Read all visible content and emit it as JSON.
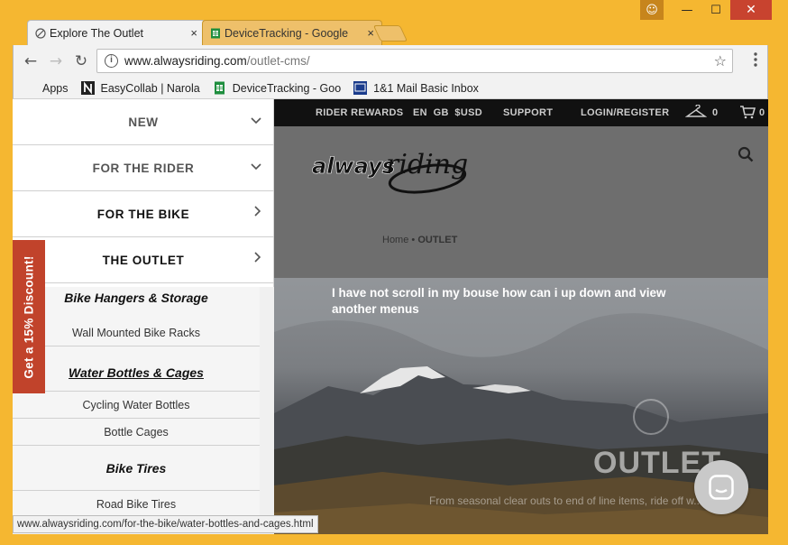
{
  "window": {
    "controls": {
      "user": "☺",
      "minimize": "—",
      "maximize": "☐",
      "close": "✕"
    }
  },
  "tabs": [
    {
      "label": "Explore The Outlet",
      "icon": "site-favicon",
      "close": "×"
    },
    {
      "label": "DeviceTracking - Google",
      "icon": "sheets-icon",
      "close": "×"
    }
  ],
  "toolbar": {
    "back": "←",
    "forward": "→",
    "reload": "↻",
    "url_host": "www.alwaysriding.com",
    "url_path": "/outlet-cms/",
    "star": "☆",
    "menu": "⋮"
  },
  "bookmarks": [
    {
      "label": "Apps",
      "icon": "apps-grid-icon"
    },
    {
      "label": "EasyCollab | Narola",
      "icon": "n-logo-icon"
    },
    {
      "label": "DeviceTracking - Goo",
      "icon": "sheets-icon"
    },
    {
      "label": "1&1 Mail Basic Inbox",
      "icon": "mail-icon"
    }
  ],
  "site": {
    "topbar": {
      "rewards": "RIDER REWARDS",
      "locale": "EN  GB  $USD",
      "support": "SUPPORT",
      "login": "LOGIN/REGISTER",
      "wishlist_count": "0",
      "cart_count": "0"
    },
    "breadcrumb": {
      "home": "Home",
      "sep": "•",
      "current": "OUTLET"
    },
    "hero": {
      "note": "I have not scroll in my bouse how can i up down and view another menus",
      "title": "OUTLET",
      "subtitle": "From seasonal clear outs to end of line items, ride off w... ...ed o"
    }
  },
  "sidemenu": {
    "items": [
      {
        "label": "NEW",
        "chevron": "⌵"
      },
      {
        "label": "FOR THE RIDER",
        "chevron": "⌵"
      },
      {
        "label": "FOR THE BIKE",
        "chevron": "›"
      },
      {
        "label": "THE OUTLET",
        "chevron": "›"
      }
    ],
    "sub": [
      {
        "label": "Bike Hangers & Storage",
        "type": "head"
      },
      {
        "label": "Wall Mounted Bike Racks",
        "type": "item"
      },
      {
        "label": "Water Bottles & Cages",
        "type": "head"
      },
      {
        "label": "Cycling Water Bottles",
        "type": "item"
      },
      {
        "label": "Bottle Cages",
        "type": "item"
      },
      {
        "label": "Bike Tires",
        "type": "head"
      },
      {
        "label": "Road Bike Tires",
        "type": "item"
      }
    ],
    "discount": "Get a 15% Discount!"
  },
  "statusbar": {
    "url": "www.alwaysriding.com/for-the-bike/water-bottles-and-cages.html"
  },
  "colors": {
    "frame": "#f5b731",
    "discount": "#c1432b",
    "topbar": "#111111"
  }
}
